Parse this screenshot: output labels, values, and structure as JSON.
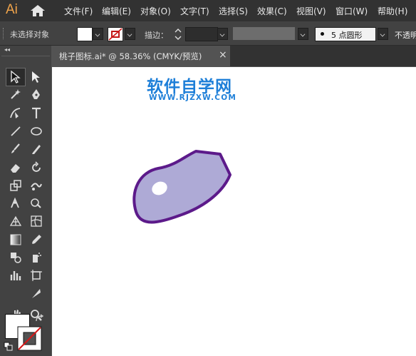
{
  "app": {
    "logo": "Ai"
  },
  "menu": [
    "文件(F)",
    "编辑(E)",
    "对象(O)",
    "文字(T)",
    "选择(S)",
    "效果(C)",
    "视图(V)",
    "窗口(W)",
    "帮助(H)"
  ],
  "control_bar": {
    "selection_status": "未选择对象",
    "stroke_label": "描边：",
    "brush_value": "5 点圆形",
    "opacity_label": "不透明"
  },
  "document_tab": {
    "label": "桃子图标.ai* @ 58.36% (CMYK/预览)",
    "close": "×"
  },
  "watermark": {
    "title": "软件自学网",
    "subtitle": "WWW.RJZXW.COM"
  },
  "tools": [
    "selection-tool",
    "direct-selection-tool",
    "magic-wand-tool",
    "pen-tool",
    "curvature-tool",
    "type-tool",
    "line-tool",
    "ellipse-tool",
    "paintbrush-tool",
    "pencil-tool",
    "eraser-tool",
    "rotate-tool",
    "scale-tool",
    "warp-tool",
    "puppet-warp-tool",
    "shape-builder-tool",
    "perspective-grid-tool",
    "mesh-tool",
    "gradient-tool",
    "eyedropper-tool",
    "blend-tool",
    "symbol-sprayer-tool",
    "column-graph-tool",
    "artboard-tool",
    "slice-tool",
    "hand-tool",
    "zoom-tool"
  ],
  "colors": {
    "peach_fill": "#aeaad6",
    "peach_stroke": "#5c1a8a",
    "highlight": "#ffffff",
    "watermark": "#1e7fd8",
    "menubar_bg": "#323232",
    "panel_bg": "#424242"
  }
}
